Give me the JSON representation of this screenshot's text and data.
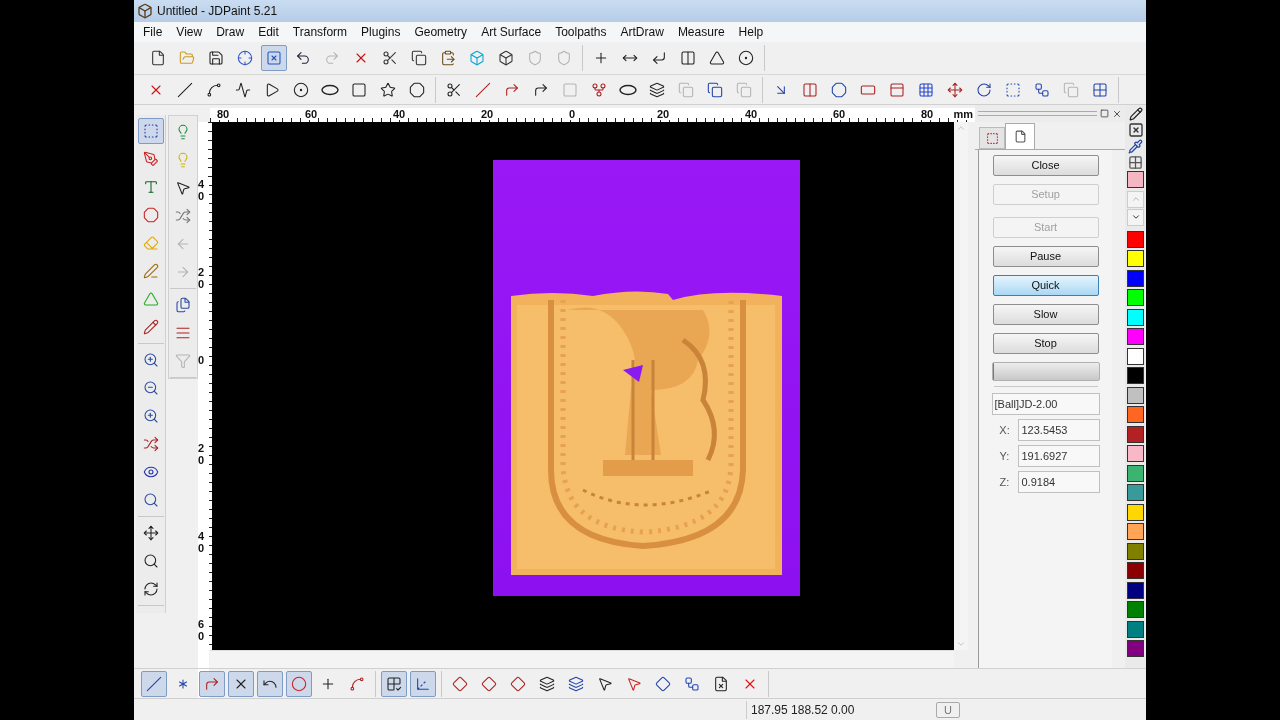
{
  "window": {
    "title": "Untitled - JDPaint 5.21"
  },
  "menu": [
    "File",
    "View",
    "Draw",
    "Edit",
    "Transform",
    "Plugins",
    "Geometry",
    "Art Surface",
    "Toolpaths",
    "ArtDraw",
    "Measure",
    "Help"
  ],
  "toolbar_1": [
    [
      {
        "pressed": false,
        "disabled": false
      },
      {
        "pressed": false,
        "disabled": false
      },
      {
        "pressed": false,
        "disabled": false
      },
      {
        "pressed": false,
        "disabled": false
      },
      {
        "pressed": true,
        "disabled": false
      },
      {
        "pressed": false,
        "disabled": false
      },
      {
        "pressed": false,
        "disabled": true
      },
      {
        "pressed": false,
        "disabled": false
      },
      {
        "pressed": false,
        "disabled": false
      },
      {
        "pressed": false,
        "disabled": false
      },
      {
        "pressed": false,
        "disabled": false
      },
      {
        "pressed": false,
        "disabled": false
      },
      {
        "pressed": false,
        "disabled": false
      },
      {
        "pressed": false,
        "disabled": true
      },
      {
        "pressed": false,
        "disabled": true
      }
    ],
    [
      {
        "pressed": false,
        "disabled": false
      },
      {
        "pressed": false,
        "disabled": false
      },
      {
        "pressed": false,
        "disabled": false
      },
      {
        "pressed": false,
        "disabled": false
      },
      {
        "pressed": false,
        "disabled": false
      },
      {
        "pressed": false,
        "disabled": false
      }
    ]
  ],
  "toolbar_2": [
    [
      {
        "pressed": false,
        "disabled": false
      },
      {
        "pressed": false,
        "disabled": false
      },
      {
        "pressed": false,
        "disabled": false
      },
      {
        "pressed": false,
        "disabled": false
      },
      {
        "pressed": false,
        "disabled": false
      },
      {
        "pressed": false,
        "disabled": false
      },
      {
        "pressed": false,
        "disabled": false
      },
      {
        "pressed": false,
        "disabled": false
      },
      {
        "pressed": false,
        "disabled": false
      },
      {
        "pressed": false,
        "disabled": false
      }
    ],
    [
      {
        "pressed": false,
        "disabled": false
      },
      {
        "pressed": false,
        "disabled": false
      },
      {
        "pressed": false,
        "disabled": false
      },
      {
        "pressed": false,
        "disabled": false
      },
      {
        "pressed": false,
        "disabled": true
      },
      {
        "pressed": false,
        "disabled": false
      },
      {
        "pressed": false,
        "disabled": false
      },
      {
        "pressed": false,
        "disabled": false
      },
      {
        "pressed": false,
        "disabled": true
      },
      {
        "pressed": false,
        "disabled": false
      },
      {
        "pressed": false,
        "disabled": true
      }
    ],
    [
      {
        "pressed": false,
        "disabled": false
      },
      {
        "pressed": false,
        "disabled": false
      },
      {
        "pressed": false,
        "disabled": false
      },
      {
        "pressed": false,
        "disabled": false
      },
      {
        "pressed": false,
        "disabled": false
      },
      {
        "pressed": false,
        "disabled": false
      },
      {
        "pressed": false,
        "disabled": false
      },
      {
        "pressed": false,
        "disabled": false
      },
      {
        "pressed": false,
        "disabled": false
      },
      {
        "pressed": false,
        "disabled": false
      },
      {
        "pressed": false,
        "disabled": true
      },
      {
        "pressed": false,
        "disabled": false
      }
    ]
  ],
  "left_tools": [
    [
      {
        "pressed": true,
        "disabled": false
      },
      {
        "pressed": false,
        "disabled": false
      },
      {
        "pressed": false,
        "disabled": false
      },
      {
        "pressed": false,
        "disabled": false
      },
      {
        "pressed": false,
        "disabled": false
      },
      {
        "pressed": false,
        "disabled": false
      },
      {
        "pressed": false,
        "disabled": false
      },
      {
        "pressed": false,
        "disabled": false
      }
    ],
    [
      {
        "pressed": false,
        "disabled": false
      },
      {
        "pressed": false,
        "disabled": false
      },
      {
        "pressed": false,
        "disabled": false
      },
      {
        "pressed": false,
        "disabled": false
      },
      {
        "pressed": false,
        "disabled": false
      },
      {
        "pressed": false,
        "disabled": false
      }
    ],
    [
      {
        "pressed": false,
        "disabled": false
      },
      {
        "pressed": false,
        "disabled": false
      },
      {
        "pressed": false,
        "disabled": false
      }
    ]
  ],
  "left_tools_2": [
    [
      {
        "pressed": false,
        "disabled": false
      },
      {
        "pressed": false,
        "disabled": false
      },
      {
        "pressed": false,
        "disabled": false
      },
      {
        "pressed": false,
        "disabled": false
      },
      {
        "pressed": false,
        "disabled": true
      },
      {
        "pressed": false,
        "disabled": true
      }
    ],
    [
      {
        "pressed": false,
        "disabled": false
      },
      {
        "pressed": false,
        "disabled": false
      },
      {
        "pressed": false,
        "disabled": true
      }
    ]
  ],
  "ruler_h": [
    "80",
    "60",
    "40",
    "20",
    "0",
    "20",
    "40",
    "60",
    "80"
  ],
  "ruler_unit": "mm",
  "ruler_v": [
    "40",
    "20",
    "0",
    "20",
    "40",
    "60"
  ],
  "canvas": {
    "kind": "picture"
  },
  "panel_buttons": [
    {
      "label": "Close",
      "disabled": false,
      "hovered": false
    },
    {
      "label": "Setup",
      "disabled": true,
      "hovered": false
    },
    {
      "label": "Start",
      "disabled": true,
      "hovered": false
    },
    {
      "label": "Pause",
      "disabled": false,
      "hovered": false
    },
    {
      "label": "Quick",
      "disabled": false,
      "hovered": true
    },
    {
      "label": "Slow",
      "disabled": false,
      "hovered": false
    },
    {
      "label": "Stop",
      "disabled": false,
      "hovered": false
    }
  ],
  "progress": {
    "level": 0.01
  },
  "tool_field": "[Ball]JD-2.00",
  "coords": [
    {
      "label": "X:",
      "value": "123.5453"
    },
    {
      "label": "Y:",
      "value": "191.6927"
    },
    {
      "label": "Z:",
      "value": "0.9184"
    }
  ],
  "palette": [
    {
      "color": "#f4b6c2"
    },
    {
      "color": "#ff0000"
    },
    {
      "color": "#ffff00"
    },
    {
      "color": "#0000ff"
    },
    {
      "color": "#00ff00"
    },
    {
      "color": "#00ffff"
    },
    {
      "color": "#ff00ff"
    },
    {
      "color": "#ffffff"
    },
    {
      "color": "#000000"
    },
    {
      "color": "#c0c0c0"
    },
    {
      "color": "#ff6622"
    },
    {
      "color": "#b22222"
    },
    {
      "color": "#f8b8c8"
    },
    {
      "color": "#3cb371"
    },
    {
      "color": "#3a9a9a"
    },
    {
      "color": "#ffd700"
    },
    {
      "color": "#ffa555"
    },
    {
      "color": "#808000"
    },
    {
      "color": "#8b0000"
    },
    {
      "color": "#000080"
    },
    {
      "color": "#008000"
    },
    {
      "color": "#008080"
    },
    {
      "color": "#800080"
    }
  ],
  "bottom_toolbar": [
    [
      {
        "pressed": true,
        "disabled": false
      },
      {
        "pressed": false,
        "disabled": false
      },
      {
        "pressed": true,
        "disabled": false
      },
      {
        "pressed": true,
        "disabled": false
      },
      {
        "pressed": true,
        "disabled": false
      },
      {
        "pressed": true,
        "disabled": false
      },
      {
        "pressed": false,
        "disabled": false
      },
      {
        "pressed": false,
        "disabled": false
      }
    ],
    [
      {
        "pressed": true,
        "disabled": false
      },
      {
        "pressed": true,
        "disabled": false
      }
    ],
    [
      {
        "pressed": false,
        "disabled": false
      },
      {
        "pressed": false,
        "disabled": false
      },
      {
        "pressed": false,
        "disabled": false
      },
      {
        "pressed": false,
        "disabled": false
      },
      {
        "pressed": false,
        "disabled": false
      },
      {
        "pressed": false,
        "disabled": false
      },
      {
        "pressed": false,
        "disabled": false
      },
      {
        "pressed": false,
        "disabled": false
      },
      {
        "pressed": false,
        "disabled": false
      },
      {
        "pressed": false,
        "disabled": false
      },
      {
        "pressed": false,
        "disabled": false
      }
    ]
  ],
  "status_bar": {
    "coordinates": "187.95 188.52 0.00",
    "mode": "U"
  }
}
